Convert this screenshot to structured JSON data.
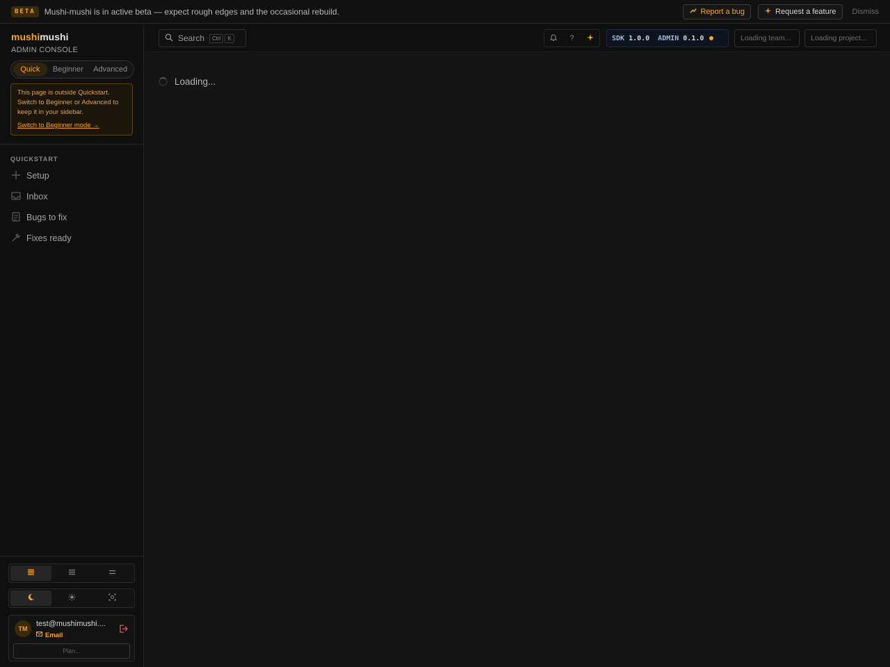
{
  "banner": {
    "badge": "BETA",
    "message": "Mushi-mushi is in active beta — expect rough edges and the occasional rebuild.",
    "report_bug": "Report a bug",
    "request_feature": "Request a feature",
    "dismiss": "Dismiss"
  },
  "brand": {
    "name_a": "mushi",
    "name_b": "mushi",
    "subtitle": "ADMIN CONSOLE"
  },
  "mode": {
    "options": [
      "Quick",
      "Beginner",
      "Advanced"
    ],
    "selected": "Quick"
  },
  "notice": {
    "text": "This page is outside Quickstart. Switch to Beginner or Advanced to keep it in your sidebar.",
    "link": "Switch to Beginner mode →"
  },
  "sidebar": {
    "section": "QUICKSTART",
    "items": [
      {
        "label": "Setup",
        "icon": "plus-icon"
      },
      {
        "label": "Inbox",
        "icon": "inbox-icon"
      },
      {
        "label": "Bugs to fix",
        "icon": "document-icon"
      },
      {
        "label": "Fixes ready",
        "icon": "wrench-icon"
      }
    ]
  },
  "density": {
    "options": [
      "compact",
      "comfortable",
      "spacious"
    ],
    "selected": "compact"
  },
  "theme": {
    "options": [
      "dark",
      "light",
      "system"
    ],
    "selected": "dark"
  },
  "user": {
    "initials": "TM",
    "email": "test@mushimushi....",
    "method": "Email",
    "plan": "Plan..."
  },
  "topbar": {
    "search_label": "Search",
    "kbd_1": "Ctrl",
    "kbd_2": "K",
    "help_glyph": "?",
    "sdk_label": "SDK",
    "sdk_version": "1.0.0",
    "admin_label": "ADMIN",
    "admin_version": "0.1.0",
    "team": "Loading team...",
    "project": "Loading project..."
  },
  "main": {
    "loading": "Loading..."
  },
  "colors": {
    "accent": "#f5a623",
    "background": "#141414",
    "sidebar": "#0f0f0f"
  }
}
